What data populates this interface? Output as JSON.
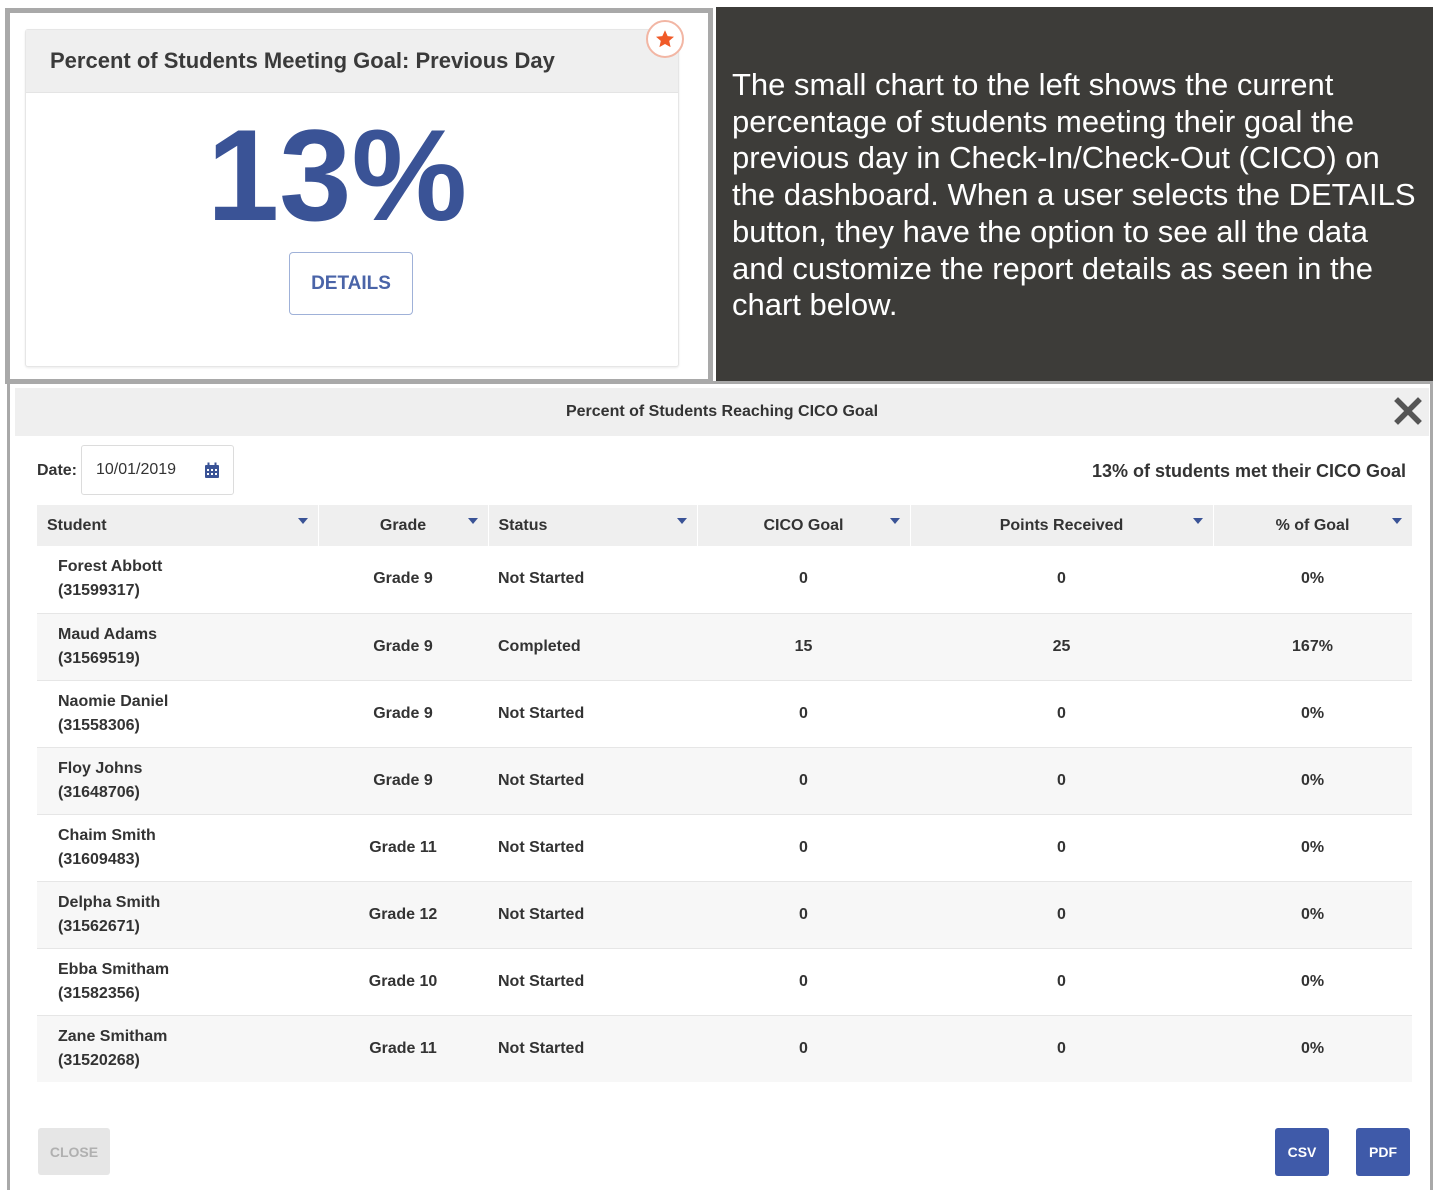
{
  "widget": {
    "title": "Percent of Students Meeting Goal: Previous Day",
    "value": "13%",
    "details_label": "DETAILS",
    "favorite_icon": "star-icon",
    "accent_color": "#3a5396",
    "favorite_color": "#f05a28"
  },
  "description": {
    "text": "The small chart to the left shows the current percentage of students meeting their goal the previous day in Check-In/Check-Out (CICO) on the dashboard. When a user selects the DETAILS button, they have the option to see all the data and customize the report details as seen in the chart below."
  },
  "modal": {
    "title": "Percent of Students Reaching CICO Goal",
    "date_label": "Date:",
    "date_value": "10/01/2019",
    "summary": "13% of students met their CICO Goal",
    "columns": [
      "Student",
      "Grade",
      "Status",
      "CICO Goal",
      "Points Received",
      "% of Goal"
    ],
    "rows": [
      {
        "name": "Forest Abbott",
        "id": "(31599317)",
        "grade": "Grade 9",
        "status": "Not Started",
        "goal": "0",
        "points": "0",
        "percent": "0%"
      },
      {
        "name": "Maud Adams",
        "id": "(31569519)",
        "grade": "Grade 9",
        "status": "Completed",
        "goal": "15",
        "points": "25",
        "percent": "167%"
      },
      {
        "name": "Naomie Daniel",
        "id": "(31558306)",
        "grade": "Grade 9",
        "status": "Not Started",
        "goal": "0",
        "points": "0",
        "percent": "0%"
      },
      {
        "name": "Floy Johns",
        "id": "(31648706)",
        "grade": "Grade 9",
        "status": "Not Started",
        "goal": "0",
        "points": "0",
        "percent": "0%"
      },
      {
        "name": "Chaim Smith",
        "id": "(31609483)",
        "grade": "Grade 11",
        "status": "Not Started",
        "goal": "0",
        "points": "0",
        "percent": "0%"
      },
      {
        "name": "Delpha Smith",
        "id": "(31562671)",
        "grade": "Grade 12",
        "status": "Not Started",
        "goal": "0",
        "points": "0",
        "percent": "0%"
      },
      {
        "name": "Ebba Smitham",
        "id": "(31582356)",
        "grade": "Grade 10",
        "status": "Not Started",
        "goal": "0",
        "points": "0",
        "percent": "0%"
      },
      {
        "name": "Zane Smitham",
        "id": "(31520268)",
        "grade": "Grade 11",
        "status": "Not Started",
        "goal": "0",
        "points": "0",
        "percent": "0%"
      }
    ],
    "close_label": "CLOSE",
    "csv_label": "CSV",
    "pdf_label": "PDF",
    "button_color": "#3f5aa9"
  }
}
